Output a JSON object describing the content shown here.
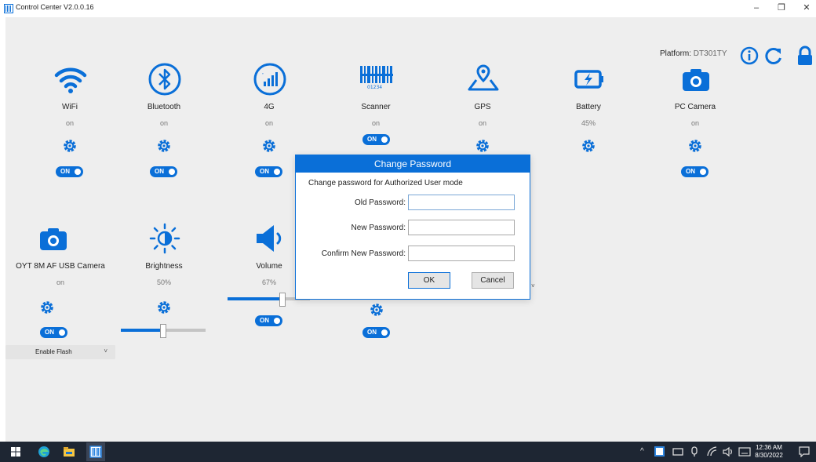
{
  "window": {
    "title": "Control Center V2.0.0.16",
    "controls": {
      "minimize": "–",
      "maximize": "❐",
      "close": "✕"
    }
  },
  "header": {
    "platform_label": "Platform:",
    "platform_value": "DT301TY",
    "icons": [
      "info-icon",
      "refresh-icon",
      "lock-icon"
    ]
  },
  "tiles": [
    {
      "name": "WiFi",
      "status": "on",
      "icon": "wifi-icon",
      "toggle": "ON"
    },
    {
      "name": "Bluetooth",
      "status": "on",
      "icon": "bluetooth-icon",
      "toggle": "ON"
    },
    {
      "name": "4G",
      "status": "on",
      "icon": "cellular-4g-icon",
      "toggle": "ON"
    },
    {
      "name": "Scanner",
      "status": "on",
      "icon": "barcode-scanner-icon",
      "toggle": "ON"
    },
    {
      "name": "GPS",
      "status": "on",
      "icon": "gps-map-icon"
    },
    {
      "name": "Battery",
      "status": "45%",
      "icon": "battery-charging-icon"
    },
    {
      "name": "PC Camera",
      "status": "on",
      "icon": "camera-icon",
      "toggle": "ON"
    }
  ],
  "tiles_row2": [
    {
      "name": "OYT 8M AF USB Camera",
      "status": "on",
      "icon": "camera-icon",
      "toggle": "ON"
    },
    {
      "name": "Brightness",
      "status": "50%",
      "icon": "brightness-icon",
      "level": 0.5
    },
    {
      "name": "Volume",
      "status": "67%",
      "icon": "volume-icon",
      "toggle": "ON",
      "level": 0.67
    },
    {
      "toggle": "ON"
    }
  ],
  "flash_select": {
    "value": "Enable Flash",
    "chevron": "˅"
  },
  "dialog": {
    "title": "Change Password",
    "description": "Change password for Authorized User mode",
    "old_label": "Old Password:",
    "new_label": "New Password:",
    "confirm_label": "Confirm New Password:",
    "old_value": "",
    "new_value": "",
    "confirm_value": "",
    "ok": "OK",
    "cancel": "Cancel"
  },
  "taskbar": {
    "time": "12:36 AM",
    "date": "8/30/2022",
    "tray_chevron": "^"
  },
  "colors": {
    "accent": "#0a6fd8",
    "background": "#eeeeee",
    "taskbar": "#1e2633"
  }
}
